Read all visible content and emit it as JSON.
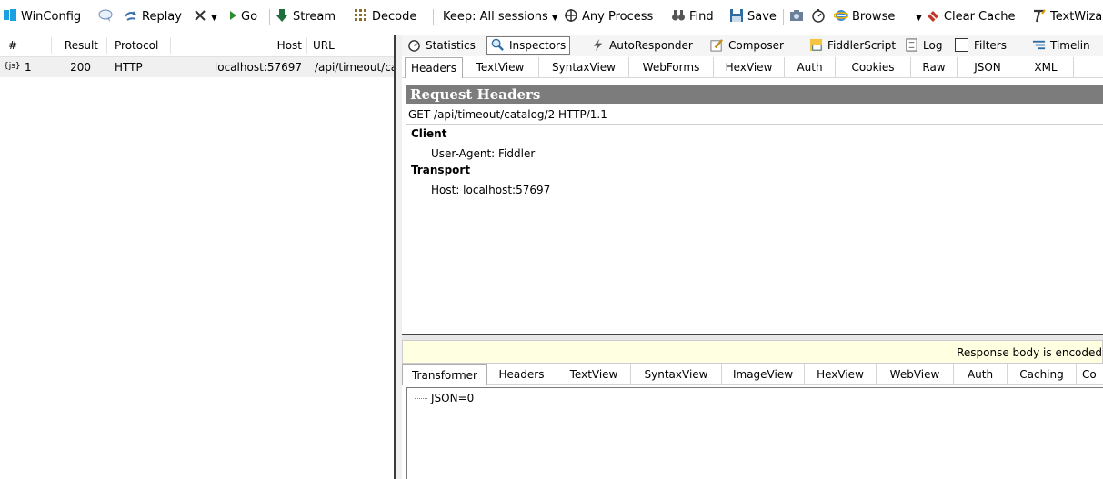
{
  "toolbar": {
    "winconfig": "WinConfig",
    "replay": "Replay",
    "go": "Go",
    "stream": "Stream",
    "decode": "Decode",
    "keep": "Keep: All sessions",
    "any_process": "Any Process",
    "find": "Find",
    "save": "Save",
    "browse": "Browse",
    "clear_cache": "Clear Cache",
    "textwizard": "TextWiza"
  },
  "sessions": {
    "columns": [
      "#",
      "Result",
      "Protocol",
      "Host",
      "URL"
    ],
    "rows": [
      {
        "num": "1",
        "icon_text": "{js}",
        "result": "200",
        "protocol": "HTTP",
        "host": "localhost:57697",
        "url": "/api/timeout/ca"
      }
    ]
  },
  "main_tabs": {
    "statistics": "Statistics",
    "inspectors": "Inspectors",
    "autoresponder": "AutoResponder",
    "composer": "Composer",
    "fiddlerscript": "FiddlerScript",
    "log": "Log",
    "filters": "Filters",
    "timeline": "Timelin"
  },
  "request_tabs": [
    "Headers",
    "TextView",
    "SyntaxView",
    "WebForms",
    "HexView",
    "Auth",
    "Cookies",
    "Raw",
    "JSON",
    "XML"
  ],
  "request": {
    "title": "Request Headers",
    "request_line": "GET /api/timeout/catalog/2 HTTP/1.1",
    "groups": [
      {
        "name": "Client",
        "items": [
          "User-Agent: Fiddler"
        ]
      },
      {
        "name": "Transport",
        "items": [
          "Host: localhost:57697"
        ]
      }
    ]
  },
  "response": {
    "notice": "Response body is encoded",
    "tabs": [
      "Transformer",
      "Headers",
      "TextView",
      "SyntaxView",
      "ImageView",
      "HexView",
      "WebView",
      "Auth",
      "Caching",
      "Co"
    ],
    "json_node": "JSON=0"
  }
}
